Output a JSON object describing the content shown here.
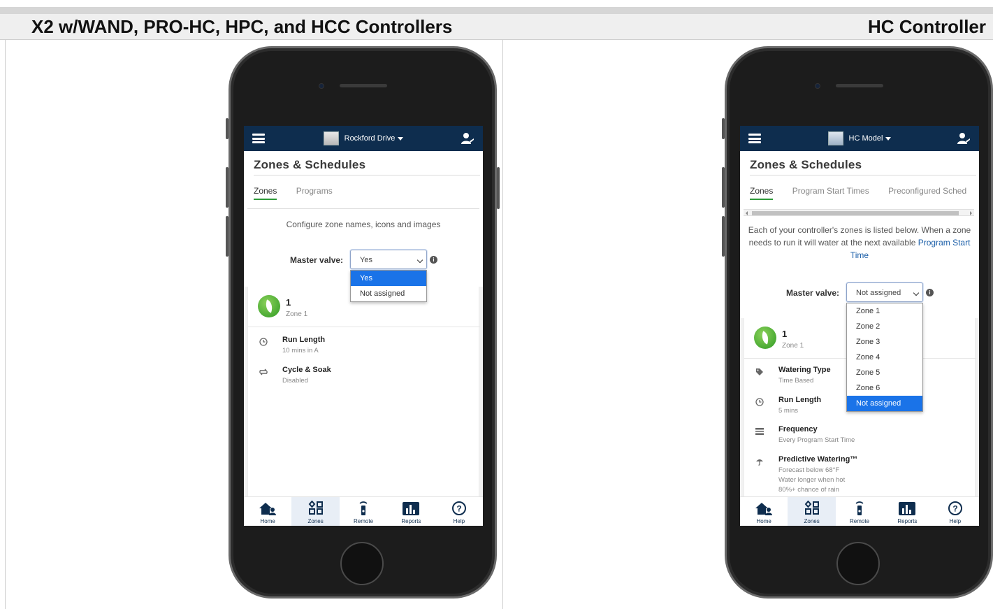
{
  "headers": {
    "left": "X2 w/WAND, PRO-HC, HPC, and HCC Controllers",
    "right": "HC Controller"
  },
  "left_phone": {
    "controller_name": "Rockford Drive",
    "page_title": "Zones & Schedules",
    "tabs": [
      "Zones",
      "Programs"
    ],
    "description": "Configure zone names, icons and images",
    "master_valve_label": "Master valve:",
    "master_valve_value": "Yes",
    "dropdown_options": [
      "Yes",
      "Not assigned"
    ],
    "selected_option": "Yes",
    "zone": {
      "number": "1",
      "name": "Zone 1"
    },
    "settings": [
      {
        "icon": "clock-icon",
        "title": "Run Length",
        "subtitle": "10 mins in A"
      },
      {
        "icon": "cycle-icon",
        "title": "Cycle & Soak",
        "subtitle": "Disabled"
      }
    ]
  },
  "right_phone": {
    "controller_name": "HC Model",
    "page_title": "Zones & Schedules",
    "tabs": [
      "Zones",
      "Program Start Times",
      "Preconfigured Sched"
    ],
    "description_part1": "Each of your controller's zones is listed below. When a zone needs to run it will water at the next available ",
    "description_link": "Program Start Time",
    "master_valve_label": "Master valve:",
    "master_valve_value": "Not assigned",
    "dropdown_options": [
      "Zone 1",
      "Zone 2",
      "Zone 3",
      "Zone 4",
      "Zone 5",
      "Zone 6",
      "Not assigned"
    ],
    "selected_option": "Not assigned",
    "zone": {
      "number": "1",
      "name": "Zone 1"
    },
    "settings": [
      {
        "icon": "tag-icon",
        "title": "Watering Type",
        "subtitle": "Time Based"
      },
      {
        "icon": "clock-icon",
        "title": "Run Length",
        "subtitle": "5 mins"
      },
      {
        "icon": "calendar-icon",
        "title": "Frequency",
        "subtitle": "Every Program Start Time"
      },
      {
        "icon": "umbrella-icon",
        "title": "Predictive Watering™",
        "subtitle": "Forecast below 68°F\nWater longer when hot\n80%+ chance of rain"
      }
    ]
  },
  "bottom_nav": {
    "items": [
      {
        "label": "Home",
        "icon": "home-icon"
      },
      {
        "label": "Zones",
        "icon": "zones-icon"
      },
      {
        "label": "Remote",
        "icon": "remote-icon"
      },
      {
        "label": "Reports",
        "icon": "reports-icon"
      },
      {
        "label": "Help",
        "icon": "help-icon"
      }
    ],
    "active": "Zones"
  },
  "colors": {
    "appbar": "#0e2d4e",
    "accent_green": "#2e9a3a",
    "selected_option": "#1a73e8",
    "link": "#1a5ea8"
  }
}
